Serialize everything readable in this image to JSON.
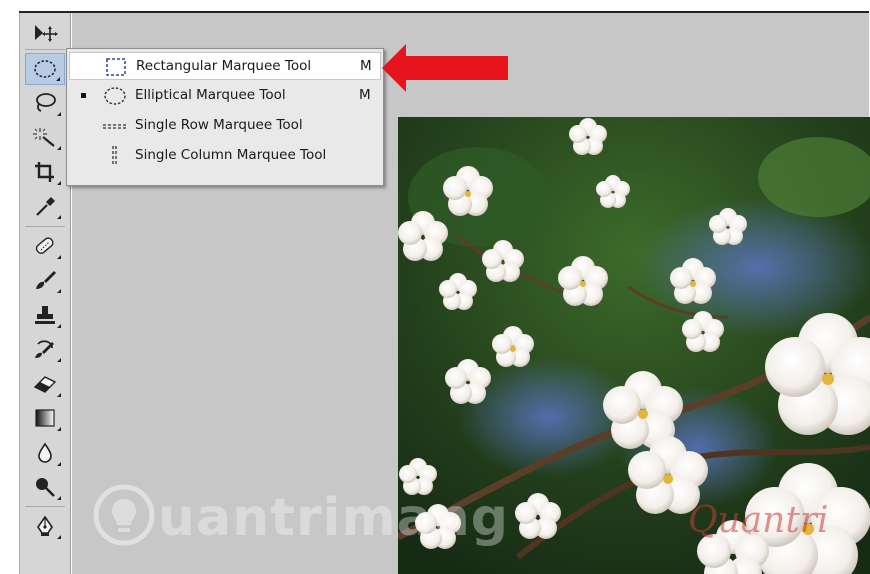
{
  "toolbar": {
    "tools": [
      {
        "name": "move-tool",
        "icon": "move-icon"
      },
      {
        "name": "marquee-tool",
        "icon": "elliptical-marquee-icon",
        "active": true
      },
      {
        "name": "lasso-tool",
        "icon": "lasso-icon"
      },
      {
        "name": "quick-selection-tool",
        "icon": "magic-wand-icon"
      },
      {
        "name": "crop-tool",
        "icon": "crop-icon"
      },
      {
        "name": "eyedropper-tool",
        "icon": "eyedropper-icon"
      },
      {
        "name": "healing-brush-tool",
        "icon": "bandage-icon"
      },
      {
        "name": "brush-tool",
        "icon": "brush-icon"
      },
      {
        "name": "clone-stamp-tool",
        "icon": "stamp-icon"
      },
      {
        "name": "history-brush-tool",
        "icon": "history-brush-icon"
      },
      {
        "name": "eraser-tool",
        "icon": "eraser-icon"
      },
      {
        "name": "gradient-tool",
        "icon": "gradient-icon"
      },
      {
        "name": "blur-tool",
        "icon": "drop-icon"
      },
      {
        "name": "dodge-tool",
        "icon": "dodge-icon"
      },
      {
        "name": "pen-tool",
        "icon": "pen-icon"
      }
    ]
  },
  "menu": {
    "items": [
      {
        "label": "Rectangular Marquee Tool",
        "shortcut": "M",
        "icon": "rectangular-marquee-icon",
        "highlighted": true,
        "selected": false
      },
      {
        "label": "Elliptical Marquee Tool",
        "shortcut": "M",
        "icon": "elliptical-marquee-icon",
        "highlighted": false,
        "selected": true
      },
      {
        "label": "Single Row Marquee Tool",
        "shortcut": "",
        "icon": "single-row-marquee-icon",
        "highlighted": false,
        "selected": false
      },
      {
        "label": "Single Column Marquee Tool",
        "shortcut": "",
        "icon": "single-column-marquee-icon",
        "highlighted": false,
        "selected": false
      }
    ]
  },
  "annotation": {
    "arrow_color": "#e8141b",
    "icon": "red-arrow-icon"
  },
  "watermark": {
    "text": "uantrimang",
    "text2": "Quantri",
    "icon": "lightbulb-logo-icon"
  },
  "colors": {
    "toolbar_bg": "#d6d6d6",
    "canvas_bg": "#c7c7c7",
    "menu_bg": "#e9e9e9",
    "active_tool_bg": "#b7cbe4"
  }
}
